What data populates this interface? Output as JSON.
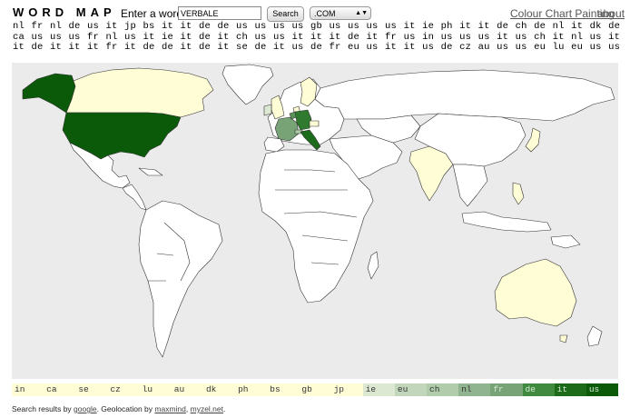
{
  "header": {
    "title": "WORD MAP",
    "enter_label": "Enter a word:",
    "word_value": "VERBALE",
    "search_label": "Search",
    "tld_value": ".COM",
    "link_colour_chart": "Colour Chart Painting",
    "link_about": "about"
  },
  "country_codes": "nl fr nl de us it jp bs it it de de us us us us gb us us us us it ie ph it it de ch de nl it dk de ca us us us fr nl us it ie it de it ch us us it it it de it fr us in us us us it us ch it nl us it it de it it it fr it de de it de it se de it us de fr eu us it it us de cz au us us eu lu eu us us",
  "legend": [
    {
      "code": "in",
      "color": "#fffdd5"
    },
    {
      "code": "ca",
      "color": "#fffdd5"
    },
    {
      "code": "se",
      "color": "#fffdd5"
    },
    {
      "code": "cz",
      "color": "#fffdd5"
    },
    {
      "code": "lu",
      "color": "#fffdd5"
    },
    {
      "code": "au",
      "color": "#fffdd5"
    },
    {
      "code": "dk",
      "color": "#fffdd5"
    },
    {
      "code": "ph",
      "color": "#fffdd5"
    },
    {
      "code": "bs",
      "color": "#fffdd5"
    },
    {
      "code": "gb",
      "color": "#fffdd5"
    },
    {
      "code": "jp",
      "color": "#fffdd5"
    },
    {
      "code": "ie",
      "color": "#dde8d2"
    },
    {
      "code": "eu",
      "color": "#c2d6bc"
    },
    {
      "code": "ch",
      "color": "#b0ccaa"
    },
    {
      "code": "nl",
      "color": "#8fb48f"
    },
    {
      "code": "fr",
      "color": "#77a377"
    },
    {
      "code": "de",
      "color": "#3f8a3f"
    },
    {
      "code": "it",
      "color": "#1b6b1b"
    },
    {
      "code": "us",
      "color": "#0a5a0a"
    }
  ],
  "map_colors": {
    "ocean": "#ebebeb",
    "land": "#ffffff",
    "pale": "#fffdd5",
    "us": "#0a5a0a",
    "it": "#1b6b1b",
    "de": "#2f7a2f",
    "fr": "#77a377",
    "nl": "#5a935a"
  },
  "footer": {
    "prefix": "Search results by",
    "google": "google",
    "mid": ". Geolocation by",
    "maxmind": "maxmind",
    "sep": ",",
    "myzel": "myzel.net",
    "end": "."
  }
}
